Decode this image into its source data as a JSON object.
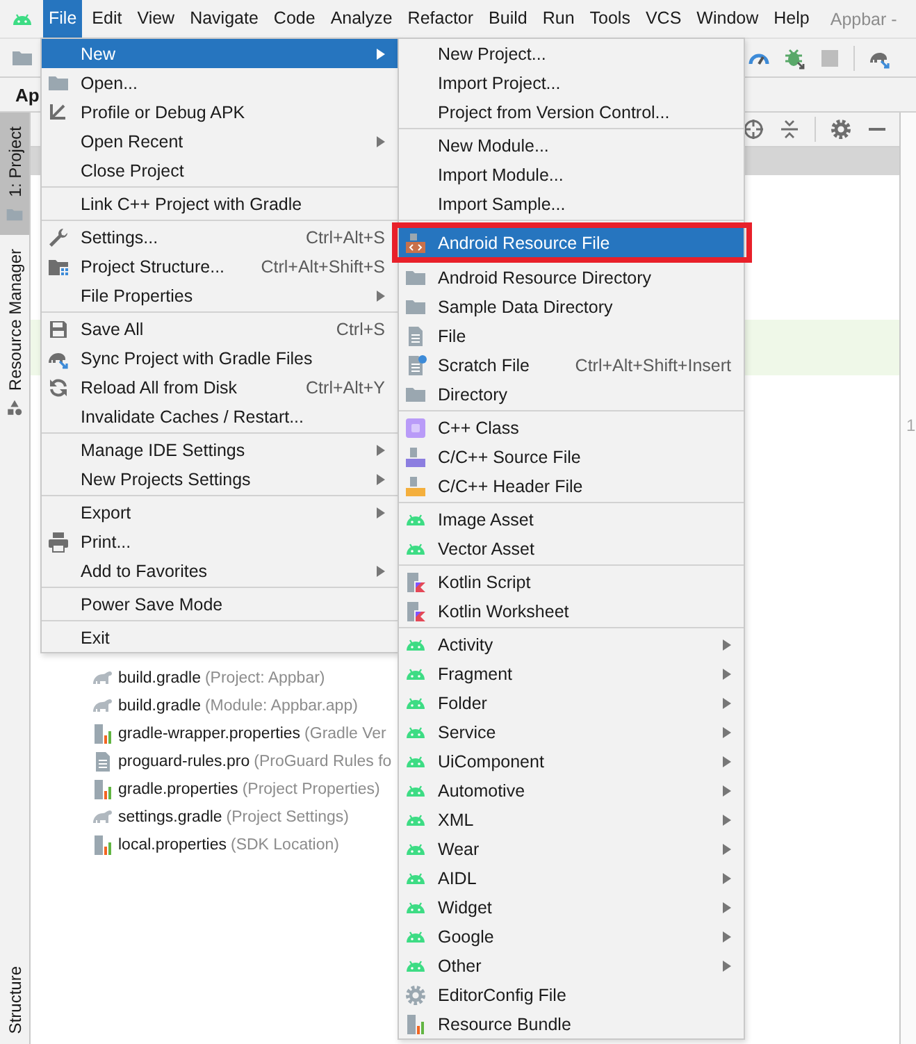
{
  "menubar": {
    "items": [
      {
        "label": "File",
        "selected": true
      },
      {
        "label": "Edit",
        "selected": false
      },
      {
        "label": "View",
        "selected": false
      },
      {
        "label": "Navigate",
        "selected": false
      },
      {
        "label": "Code",
        "selected": false
      },
      {
        "label": "Analyze",
        "selected": false
      },
      {
        "label": "Refactor",
        "selected": false
      },
      {
        "label": "Build",
        "selected": false
      },
      {
        "label": "Run",
        "selected": false
      },
      {
        "label": "Tools",
        "selected": false
      },
      {
        "label": "VCS",
        "selected": false
      },
      {
        "label": "Window",
        "selected": false
      },
      {
        "label": "Help",
        "selected": false
      }
    ],
    "title": "Appbar -"
  },
  "project_tab": "Ap",
  "side_tabs_top": [
    {
      "label": "1: Project",
      "selected": true,
      "kind": "folder"
    },
    {
      "label": "Resource Manager",
      "selected": false,
      "kind": "shapes"
    }
  ],
  "side_tabs_bottom": [
    {
      "label": "Structure",
      "selected": false
    }
  ],
  "project_files": [
    {
      "name": "build.gradle",
      "hint": "(Project: Appbar)",
      "kind": "gradle"
    },
    {
      "name": "build.gradle",
      "hint": "(Module: Appbar.app)",
      "kind": "gradle"
    },
    {
      "name": "gradle-wrapper.properties",
      "hint": "(Gradle Ver",
      "kind": "bundle"
    },
    {
      "name": "proguard-rules.pro",
      "hint": "(ProGuard Rules fo",
      "kind": "file"
    },
    {
      "name": "gradle.properties",
      "hint": "(Project Properties)",
      "kind": "bundle"
    },
    {
      "name": "settings.gradle",
      "hint": "(Project Settings)",
      "kind": "gradle"
    },
    {
      "name": "local.properties",
      "hint": "(SDK Location)",
      "kind": "bundle"
    }
  ],
  "editor": {
    "line_number": "1"
  },
  "file_menu": {
    "groups": [
      {
        "items": [
          {
            "label": "New",
            "selected": true,
            "submenu": true
          },
          {
            "label": "Open...",
            "kind": "folder",
            "selected": false,
            "submenu": false
          },
          {
            "label": "Profile or Debug APK",
            "kind": "profile",
            "selected": false,
            "submenu": false
          },
          {
            "label": "Open Recent",
            "selected": false,
            "submenu": true
          },
          {
            "label": "Close Project",
            "selected": false,
            "submenu": false
          }
        ]
      },
      {
        "items": [
          {
            "label": "Link C++ Project with Gradle",
            "selected": false,
            "submenu": false
          }
        ]
      },
      {
        "items": [
          {
            "label": "Settings...",
            "kind": "wrench",
            "shortcut": "Ctrl+Alt+S",
            "selected": false,
            "submenu": false
          },
          {
            "label": "Project Structure...",
            "kind": "structure",
            "shortcut": "Ctrl+Alt+Shift+S",
            "selected": false,
            "submenu": false
          },
          {
            "label": "File Properties",
            "selected": false,
            "submenu": true
          }
        ]
      },
      {
        "items": [
          {
            "label": "Save All",
            "kind": "save",
            "shortcut": "Ctrl+S",
            "selected": false,
            "submenu": false
          },
          {
            "label": "Sync Project with Gradle Files",
            "kind": "sync",
            "selected": false,
            "submenu": false
          },
          {
            "label": "Reload All from Disk",
            "kind": "reload",
            "shortcut": "Ctrl+Alt+Y",
            "selected": false,
            "submenu": false
          },
          {
            "label": "Invalidate Caches / Restart...",
            "selected": false,
            "submenu": false
          }
        ]
      },
      {
        "items": [
          {
            "label": "Manage IDE Settings",
            "selected": false,
            "submenu": true
          },
          {
            "label": "New Projects Settings",
            "selected": false,
            "submenu": true
          }
        ]
      },
      {
        "items": [
          {
            "label": "Export",
            "selected": false,
            "submenu": true
          },
          {
            "label": "Print...",
            "kind": "printer",
            "selected": false,
            "submenu": false
          },
          {
            "label": "Add to Favorites",
            "selected": false,
            "submenu": true
          }
        ]
      },
      {
        "items": [
          {
            "label": "Power Save Mode",
            "selected": false,
            "submenu": false
          }
        ]
      },
      {
        "items": [
          {
            "label": "Exit",
            "selected": false,
            "submenu": false
          }
        ]
      }
    ]
  },
  "new_menu": {
    "groups": [
      {
        "items": [
          {
            "label": "New Project...",
            "selected": false,
            "submenu": false,
            "outlined": false
          },
          {
            "label": "Import Project...",
            "selected": false,
            "submenu": false,
            "outlined": false
          },
          {
            "label": "Project from Version Control...",
            "selected": false,
            "submenu": false,
            "outlined": false
          }
        ]
      },
      {
        "items": [
          {
            "label": "New Module...",
            "selected": false,
            "submenu": false,
            "outlined": false
          },
          {
            "label": "Import Module...",
            "selected": false,
            "submenu": false,
            "outlined": false
          },
          {
            "label": "Import Sample...",
            "selected": false,
            "submenu": false,
            "outlined": false
          }
        ]
      },
      {
        "items": [
          {
            "label": "Android Resource File",
            "kind": "resource-file",
            "selected": true,
            "submenu": false,
            "outlined": true
          },
          {
            "label": "Android Resource Directory",
            "kind": "folder",
            "selected": false,
            "submenu": false,
            "outlined": false
          },
          {
            "label": "Sample Data Directory",
            "kind": "folder",
            "selected": false,
            "submenu": false,
            "outlined": false
          },
          {
            "label": "File",
            "kind": "file",
            "selected": false,
            "submenu": false,
            "outlined": false
          },
          {
            "label": "Scratch File",
            "kind": "scratch",
            "shortcut": "Ctrl+Alt+Shift+Insert",
            "selected": false,
            "submenu": false,
            "outlined": false
          },
          {
            "label": "Directory",
            "kind": "folder",
            "selected": false,
            "submenu": false,
            "outlined": false
          }
        ]
      },
      {
        "items": [
          {
            "label": "C++ Class",
            "kind": "cpp-class",
            "selected": false,
            "submenu": false,
            "outlined": false
          },
          {
            "label": "C/C++ Source File",
            "kind": "cpp-source",
            "selected": false,
            "submenu": false,
            "outlined": false
          },
          {
            "label": "C/C++ Header File",
            "kind": "cpp-header",
            "selected": false,
            "submenu": false,
            "outlined": false
          }
        ]
      },
      {
        "items": [
          {
            "label": "Image Asset",
            "kind": "robot",
            "selected": false,
            "submenu": false,
            "outlined": false
          },
          {
            "label": "Vector Asset",
            "kind": "robot",
            "selected": false,
            "submenu": false,
            "outlined": false
          }
        ]
      },
      {
        "items": [
          {
            "label": "Kotlin Script",
            "kind": "kotlin",
            "selected": false,
            "submenu": false,
            "outlined": false
          },
          {
            "label": "Kotlin Worksheet",
            "kind": "kotlin",
            "selected": false,
            "submenu": false,
            "outlined": false
          }
        ]
      },
      {
        "items": [
          {
            "label": "Activity",
            "kind": "robot",
            "selected": false,
            "submenu": true,
            "outlined": false
          },
          {
            "label": "Fragment",
            "kind": "robot",
            "selected": false,
            "submenu": true,
            "outlined": false
          },
          {
            "label": "Folder",
            "kind": "robot",
            "selected": false,
            "submenu": true,
            "outlined": false
          },
          {
            "label": "Service",
            "kind": "robot",
            "selected": false,
            "submenu": true,
            "outlined": false
          },
          {
            "label": "UiComponent",
            "kind": "robot",
            "selected": false,
            "submenu": true,
            "outlined": false
          },
          {
            "label": "Automotive",
            "kind": "robot",
            "selected": false,
            "submenu": true,
            "outlined": false
          },
          {
            "label": "XML",
            "kind": "robot",
            "selected": false,
            "submenu": true,
            "outlined": false
          },
          {
            "label": "Wear",
            "kind": "robot",
            "selected": false,
            "submenu": true,
            "outlined": false
          },
          {
            "label": "AIDL",
            "kind": "robot",
            "selected": false,
            "submenu": true,
            "outlined": false
          },
          {
            "label": "Widget",
            "kind": "robot",
            "selected": false,
            "submenu": true,
            "outlined": false
          },
          {
            "label": "Google",
            "kind": "robot",
            "selected": false,
            "submenu": true,
            "outlined": false
          },
          {
            "label": "Other",
            "kind": "robot",
            "selected": false,
            "submenu": true,
            "outlined": false
          },
          {
            "label": "EditorConfig File",
            "kind": "gear",
            "selected": false,
            "submenu": false,
            "outlined": false
          },
          {
            "label": "Resource Bundle",
            "kind": "bundle",
            "selected": false,
            "submenu": false,
            "outlined": false
          }
        ]
      }
    ]
  }
}
